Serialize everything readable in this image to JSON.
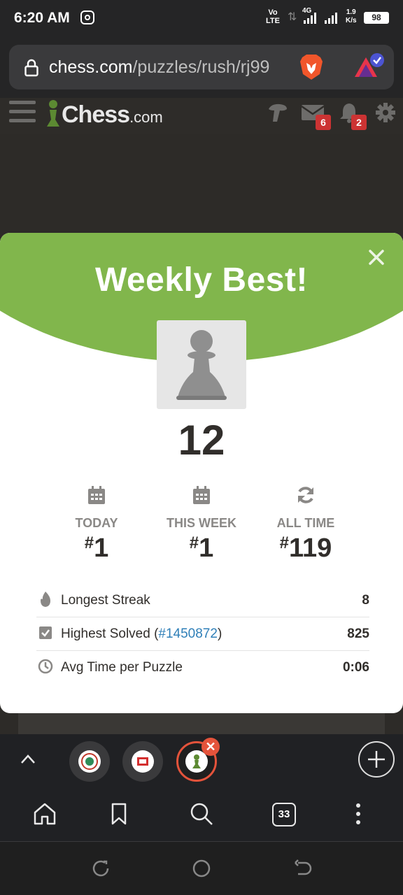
{
  "status_bar": {
    "time": "6:20 AM",
    "volte": "Vo\nLTE",
    "network": "4G",
    "speed_value": "1.9",
    "speed_unit": "K/s",
    "battery": "98"
  },
  "browser": {
    "url_domain": "chess.com",
    "url_path": "/puzzles/rush/rj99"
  },
  "site_header": {
    "logo_text": "Chess",
    "logo_suffix": ".com",
    "messages_badge": "6",
    "notifications_badge": "2"
  },
  "modal": {
    "title": "Weekly Best!",
    "score": "12",
    "stats": [
      {
        "label": "TODAY",
        "hash": "#",
        "value": "1",
        "icon": "calendar-icon"
      },
      {
        "label": "THIS WEEK",
        "hash": "#",
        "value": "1",
        "icon": "calendar-icon"
      },
      {
        "label": "ALL TIME",
        "hash": "#",
        "value": "119",
        "icon": "refresh-icon"
      }
    ],
    "rows": [
      {
        "label": "Longest Streak",
        "value": "8",
        "icon": "flame-icon"
      },
      {
        "label_prefix": "Highest Solved (",
        "link": "#1450872",
        "label_suffix": ")",
        "value": "825",
        "icon": "checkbox-icon"
      },
      {
        "label": "Avg Time per Puzzle",
        "value": "0:06",
        "icon": "clock-icon"
      }
    ]
  },
  "tab_bar": {
    "open_tabs_count": "33"
  },
  "colors": {
    "chess_green": "#81b64c",
    "link_blue": "#2f7fb8",
    "badge_red": "#cc3333",
    "active_tab_ring": "#e4533b"
  }
}
